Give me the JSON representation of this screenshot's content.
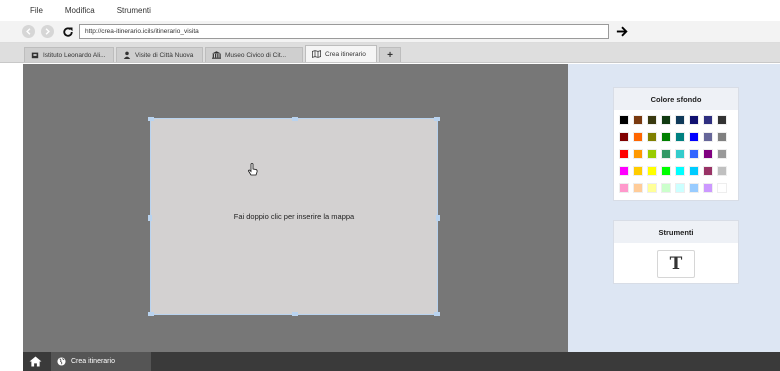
{
  "menubar": {
    "items": [
      "File",
      "Modifica",
      "Strumenti"
    ]
  },
  "navbar": {
    "url": "http://crea-itinerario.icils/itinerario_visita"
  },
  "tabs": [
    {
      "label": "Istituto Leonardo Ali...",
      "icon": "school-icon",
      "active": false
    },
    {
      "label": "Visite di Città Nuova",
      "icon": "person-icon",
      "active": false
    },
    {
      "label": "Museo Civico di Cit...",
      "icon": "museum-icon",
      "active": false
    },
    {
      "label": "Crea itinerario",
      "icon": "map-icon",
      "active": true
    }
  ],
  "add_tab_label": "+",
  "canvas": {
    "placeholder": "Fai doppio clic per inserire la mappa"
  },
  "sidebar": {
    "colors_title": "Colore sfondo",
    "colors": [
      "#000000",
      "#7a3a10",
      "#3a3a10",
      "#103a10",
      "#103a5a",
      "#101070",
      "#303080",
      "#333333",
      "#800000",
      "#ff6600",
      "#808000",
      "#008000",
      "#008080",
      "#0000ff",
      "#666699",
      "#808080",
      "#ff0000",
      "#ff9900",
      "#99cc00",
      "#339966",
      "#33cccc",
      "#3366ff",
      "#800080",
      "#999999",
      "#ff00ff",
      "#ffcc00",
      "#ffff00",
      "#00ff00",
      "#00ffff",
      "#00ccff",
      "#993366",
      "#c0c0c0",
      "#ff99cc",
      "#ffcc99",
      "#ffff99",
      "#ccffcc",
      "#ccffff",
      "#99ccff",
      "#cc99ff",
      "#ffffff"
    ],
    "tools_title": "Strumenti",
    "text_tool_label": "T"
  },
  "taskbar": {
    "item_label": "Crea itinerario"
  }
}
